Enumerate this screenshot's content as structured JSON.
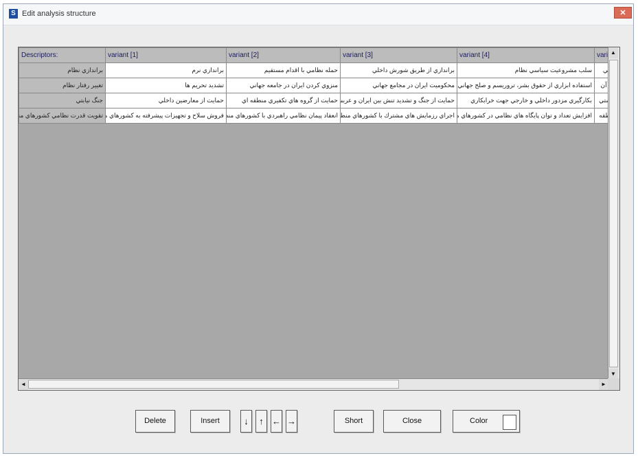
{
  "window": {
    "title": "Edit analysis structure",
    "app_icon_letter": "S",
    "close_glyph": "✕"
  },
  "grid": {
    "columns": [
      "Descriptors:",
      "variant [1]",
      "variant [2]",
      "variant [3]",
      "variant [4]",
      "variant"
    ],
    "rows": [
      {
        "descriptor": "براندازي نظام",
        "cells": [
          "براندازي نرم",
          "حمله نظامي با اقدام مستقيم",
          "براندازي از طريق شورش داخلي",
          "سلب مشروعيت سياسي نظام",
          "ي جمعي"
        ]
      },
      {
        "descriptor": "تغيير رفتار نظام",
        "cells": [
          "تشديد تحريم ها",
          "منزوي كردن ايران در جامعه جهاني",
          "محكوميت ايران در مجامع جهاني",
          "استفاده ابزاري از حقوق بشر، تروريسم و صلح جهاني",
          "توسعه آن"
        ]
      },
      {
        "descriptor": "جنگ نيابتي",
        "cells": [
          "حمايت از معارضين داخلي",
          "حمايت از گروه هاي تكفيري منطقه اي",
          "حمايت از جنگ و تشديد تنش بين ايران و عربستان",
          "بكارگيري مزدور داخلي و خارجي جهت خرابكاري",
          "جهوتيستي"
        ]
      },
      {
        "descriptor": "تقويت قدرت نظامي كشورهاي منطقه",
        "cells": [
          "فروش سلاح و تجهيزات پيشرفته به كشورهاي منطقه",
          "انعقاد پيمان نظامي راهبردي با كشورهاي منطقه",
          "اجراي رزمايش هاي مشترك با كشورهاي منطقه",
          "افزايش تعداد و توان پايگاه هاي نظامي در كشورهاي منطقه",
          "دي منطقه"
        ]
      }
    ]
  },
  "scroll": {
    "up": "▲",
    "down": "▼",
    "left": "◄",
    "right": "►"
  },
  "buttons": {
    "delete": "Delete",
    "insert": "Insert",
    "down": "↓",
    "up": "↑",
    "left": "←",
    "right": "→",
    "short": "Short",
    "close": "Close",
    "color": "Color"
  },
  "colors": {
    "grid_background": "#a8a8a8",
    "header_background": "#bcbcbc",
    "color_swatch": "#ffffff"
  }
}
